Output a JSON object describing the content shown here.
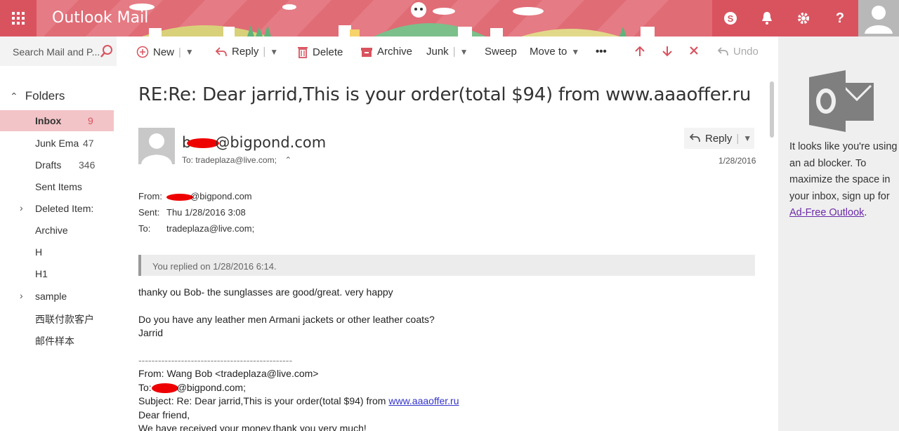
{
  "app": {
    "title": "Outlook Mail"
  },
  "search": {
    "placeholder": "Search Mail and P..."
  },
  "toolbar": {
    "new": "New",
    "reply": "Reply",
    "delete": "Delete",
    "archive": "Archive",
    "junk": "Junk",
    "sweep": "Sweep",
    "move_to": "Move to",
    "more": "•••",
    "undo": "Undo"
  },
  "nav": {
    "header": "Folders",
    "items": [
      {
        "label": "Inbox",
        "count": "9"
      },
      {
        "label": "Junk Ema",
        "count": "47"
      },
      {
        "label": "Drafts",
        "count": "346"
      },
      {
        "label": "Sent Items",
        "count": ""
      },
      {
        "label": "Deleted Item:",
        "count": ""
      },
      {
        "label": "Archive",
        "count": ""
      },
      {
        "label": "H",
        "count": ""
      },
      {
        "label": "H1",
        "count": ""
      },
      {
        "label": "sample",
        "count": ""
      },
      {
        "label": "西联付款客户",
        "count": ""
      },
      {
        "label": "邮件样本",
        "count": ""
      }
    ]
  },
  "message": {
    "subject": "RE:Re: Dear jarrid,This is your order(total $94) from www.aaaoffer.ru",
    "sender_visible": "b",
    "sender_domain": "@bigpond.com",
    "to_line": "To: tradeplaza@live.com;",
    "reply_label": "Reply",
    "date": "1/28/2016",
    "headers": {
      "from_k": "From:",
      "from_v": "@bigpond.com",
      "sent_k": "Sent:",
      "sent_v": "Thu 1/28/2016 3:08",
      "to_k": "To:",
      "to_v": "tradeplaza@live.com;"
    },
    "replied_note": "You replied on 1/28/2016 6:14.",
    "body": {
      "l1": "thanky ou Bob- the sunglasses are good/great.  very happy",
      "l2": "Do you have any leather men Armani jackets or other leather coats?",
      "l3": "Jarrid",
      "divider": "-----------------------------------------------",
      "q_from": "From: Wang Bob <tradeplaza@live.com>",
      "q_to_k": "To:",
      "q_to_v": "@bigpond.com;",
      "q_subject_prefix": "Subject: Re: Dear jarrid,This is your order(total $94) from ",
      "q_subject_link": "www.aaaoffer.ru",
      "q_greet": "Dear friend,",
      "q_line": "We have received your money,thank you very much!"
    }
  },
  "ad": {
    "text": "It looks like you're using an ad blocker. To maximize the space in your inbox, sign up for ",
    "link": "Ad-Free Outlook",
    "after": "."
  },
  "colors": {
    "accent": "#d9535f",
    "banner": "#e06c76",
    "selected": "#f2c4c7"
  }
}
